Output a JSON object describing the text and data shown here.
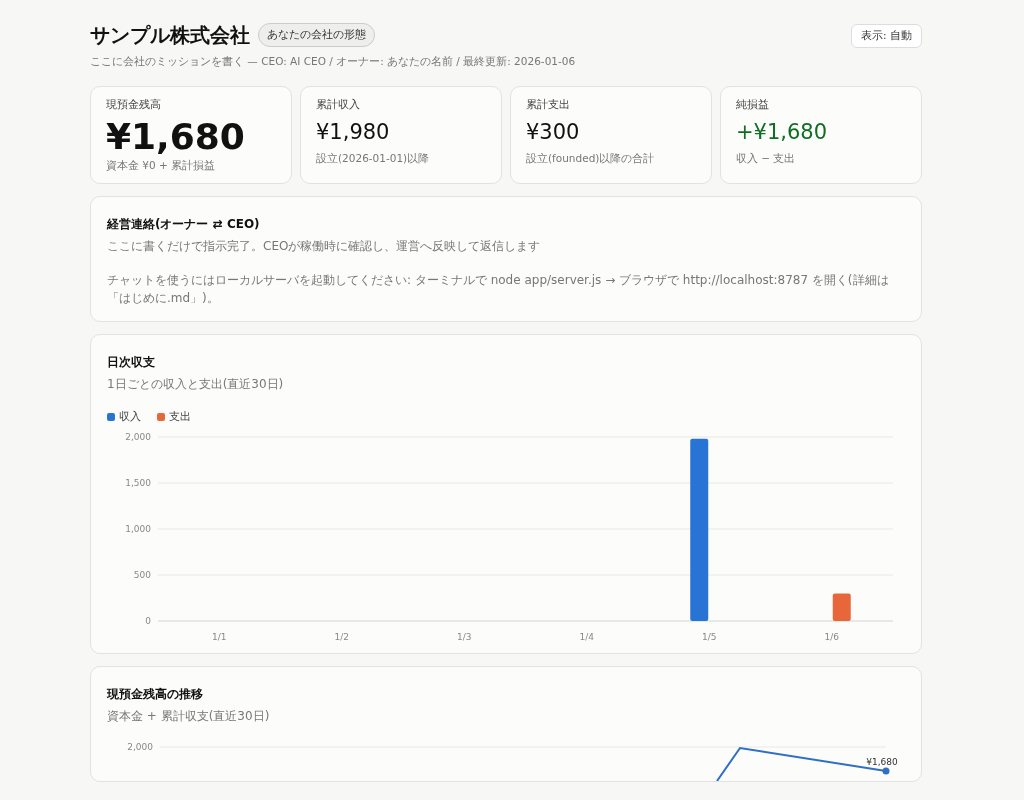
{
  "header": {
    "title": "サンプル株式会社",
    "badge": "あなたの会社の形態",
    "subtitle": "ここに会社のミッションを書く — CEO: AI CEO / オーナー: あなたの名前 / 最終更新: 2026-01-06",
    "display_button": "表示: 自動"
  },
  "kpis": [
    {
      "label": "現預金残高",
      "value": "¥1,680",
      "note": "資本金 ¥0 + 累計損益",
      "kind": "hero",
      "positive": false
    },
    {
      "label": "累計収入",
      "value": "¥1,980",
      "note": "設立(2026-01-01)以降",
      "kind": "normal",
      "positive": false
    },
    {
      "label": "累計支出",
      "value": "¥300",
      "note": "設立(founded)以降の合計",
      "kind": "normal",
      "positive": false
    },
    {
      "label": "純損益",
      "value": "+¥1,680",
      "note": "収入 − 支出",
      "kind": "normal",
      "positive": true
    }
  ],
  "message": {
    "title": "経営連絡(オーナー ⇄ CEO)",
    "description": "ここに書くだけで指示完了。CEOが稼働時に確認し、運営へ反映して返信します",
    "note": "チャットを使うにはローカルサーバを起動してください: ターミナルで node app/server.js → ブラウザで http://localhost:8787 を開く(詳細は「はじめに.md」)。"
  },
  "charts": [
    {
      "kind": "bar",
      "title": "日次収支",
      "subtitle": "1日ごとの収入と支出(直近30日)",
      "chart_data": {
        "type": "bar",
        "categories": [
          "1/1",
          "1/2",
          "1/3",
          "1/4",
          "1/5",
          "1/6"
        ],
        "series": [
          {
            "name": "収入",
            "color": "#2874d4",
            "values": [
              0,
              0,
              0,
              0,
              1980,
              0
            ]
          },
          {
            "name": "支出",
            "color": "#e8673a",
            "values": [
              0,
              0,
              0,
              0,
              0,
              300
            ]
          }
        ],
        "ylim": [
          0,
          2000
        ],
        "grid": true,
        "yticks": [
          {
            "value": 0,
            "label": "0"
          },
          {
            "value": 500,
            "label": "500"
          },
          {
            "value": 1000,
            "label": "1,000"
          },
          {
            "value": 1500,
            "label": "1,500"
          },
          {
            "value": 2000,
            "label": "2,000"
          }
        ]
      }
    },
    {
      "kind": "trend",
      "title": "現預金残高の推移",
      "subtitle": "資本金 + 累計収支(直近30日)",
      "tick_label": "2,000",
      "end_label": "¥1,680"
    }
  ]
}
